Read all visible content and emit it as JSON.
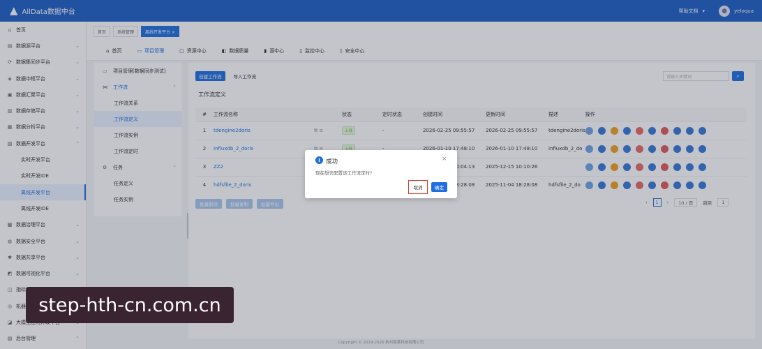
{
  "header": {
    "brand": "AllData数据中台",
    "help": "帮助文档",
    "user": "yeloqua"
  },
  "sidebar": {
    "items": [
      {
        "label": "首页",
        "icon": "home-icon",
        "arrow": ""
      },
      {
        "label": "数据源平台",
        "icon": "database-icon",
        "arrow": "⌄"
      },
      {
        "label": "数据集同步平台",
        "icon": "sync-icon",
        "arrow": "⌄"
      },
      {
        "label": "数据中枢平台",
        "icon": "hub-icon",
        "arrow": "⌄"
      },
      {
        "label": "数据汇聚平台",
        "icon": "collect-icon",
        "arrow": "⌄"
      },
      {
        "label": "数据存储平台",
        "icon": "storage-icon",
        "arrow": "⌄"
      },
      {
        "label": "数据分析平台",
        "icon": "analysis-icon",
        "arrow": "⌄"
      },
      {
        "label": "数据开发平台",
        "icon": "dev-icon",
        "arrow": "⌃"
      },
      {
        "label": "实时开发平台",
        "icon": "",
        "arrow": "",
        "sub": true
      },
      {
        "label": "实时开发IDE",
        "icon": "",
        "arrow": "",
        "sub": true
      },
      {
        "label": "离线开发平台",
        "icon": "",
        "arrow": "",
        "sub": true,
        "active": true
      },
      {
        "label": "离线开发IDE",
        "icon": "",
        "arrow": "",
        "sub": true
      },
      {
        "label": "数据治理平台",
        "icon": "governance-icon",
        "arrow": "⌄"
      },
      {
        "label": "数据安全平台",
        "icon": "security-icon",
        "arrow": "⌄"
      },
      {
        "label": "数据共享平台",
        "icon": "share-icon",
        "arrow": "⌄"
      },
      {
        "label": "数据可视化平台",
        "icon": "visual-icon",
        "arrow": "⌄"
      },
      {
        "label": "指标体系平台",
        "icon": "metric-icon",
        "arrow": "⌄"
      },
      {
        "label": "机器学习平台",
        "icon": "ml-icon",
        "arrow": "⌄"
      },
      {
        "label": "大模型应用开发平台",
        "icon": "llm-icon",
        "arrow": "⌄"
      },
      {
        "label": "后台管理",
        "icon": "admin-icon",
        "arrow": "⌃"
      }
    ]
  },
  "tags": [
    {
      "label": "首页"
    },
    {
      "label": "系统管理"
    },
    {
      "label": "离线开发平台 ×",
      "on": true
    }
  ],
  "modules": [
    {
      "label": "首页",
      "icon": "home-icon"
    },
    {
      "label": "项目管理",
      "icon": "project-icon",
      "on": true
    },
    {
      "label": "资源中心",
      "icon": "folder-icon"
    },
    {
      "label": "数据质量",
      "icon": "quality-icon"
    },
    {
      "label": "源中心",
      "icon": "datasource-icon"
    },
    {
      "label": "监控中心",
      "icon": "monitor-icon"
    },
    {
      "label": "安全中心",
      "icon": "shield-icon"
    }
  ],
  "submenu": [
    {
      "label": "项目管理[数据同步测试]",
      "type": "top",
      "icon": "project-icon"
    },
    {
      "label": "工作流",
      "type": "grp",
      "icon": "workflow-icon",
      "arrow": "⌃",
      "active": true
    },
    {
      "label": "工作流关系",
      "type": "leaf"
    },
    {
      "label": "工作流定义",
      "type": "leaf",
      "on": true
    },
    {
      "label": "工作流实例",
      "type": "leaf"
    },
    {
      "label": "工作流定时",
      "type": "leaf"
    },
    {
      "label": "任务",
      "type": "grp",
      "icon": "gear-icon",
      "arrow": "⌃"
    },
    {
      "label": "任务定义",
      "type": "leaf"
    },
    {
      "label": "任务实例",
      "type": "leaf"
    }
  ],
  "toolbar": {
    "create": "创建工作流",
    "import": "导入工作流",
    "search_placeholder": "请输入关键词"
  },
  "section_title": "工作流定义",
  "table": {
    "headers": [
      "#",
      "工作流名称",
      "",
      "状态",
      "定时状态",
      "创建时间",
      "更新时间",
      "描述",
      "操作"
    ],
    "rows": [
      {
        "idx": "1",
        "name": "tdengine2doris",
        "status": "上线",
        "timer": "-",
        "created": "2026-02-25 09:55:57",
        "updated": "2026-02-25 09:55:57",
        "desc": "tdengine2doris"
      },
      {
        "idx": "2",
        "name": "Influxdb_2_doris",
        "status": "上线",
        "timer": "-",
        "created": "2026-01-10 17:48:10",
        "updated": "2026-01-10 17:48:10",
        "desc": "influxdb_2_do"
      },
      {
        "idx": "3",
        "name": "ZZ2",
        "status": "",
        "timer": "",
        "created": "2025-12-15 10:04:13",
        "updated": "2025-12-15 10:10:26",
        "desc": ""
      },
      {
        "idx": "4",
        "name": "hdfsfile_2_doris",
        "status": "",
        "timer": "",
        "created": "2025-11-04 18:28:08",
        "updated": "2025-11-04 18:28:08",
        "desc": "hdfsfile_2_do"
      }
    ],
    "op_colors": [
      "#6fa4e8",
      "#3a78d8",
      "#f0a020",
      "#3a78d8",
      "#e86a6a",
      "#3a78d8",
      "#e05a5a",
      "#3a78d8",
      "#3a78d8",
      "#3a78d8"
    ]
  },
  "bulk": {
    "delete": "批量删除",
    "copy": "批量复制",
    "export": "批量导出"
  },
  "pager": {
    "page": "1",
    "size": "10 / 页",
    "goto": "跳至",
    "goto_page": "1"
  },
  "copyright": "Copyright © 2019-2026 杭州某某科技有限公司",
  "dialog": {
    "icon": "i",
    "title": "成功",
    "close": "×",
    "message": "现在想去配置该工作流定时?",
    "cancel": "取消",
    "confirm": "确定"
  },
  "watermark": "step-hth-cn.com.cn"
}
